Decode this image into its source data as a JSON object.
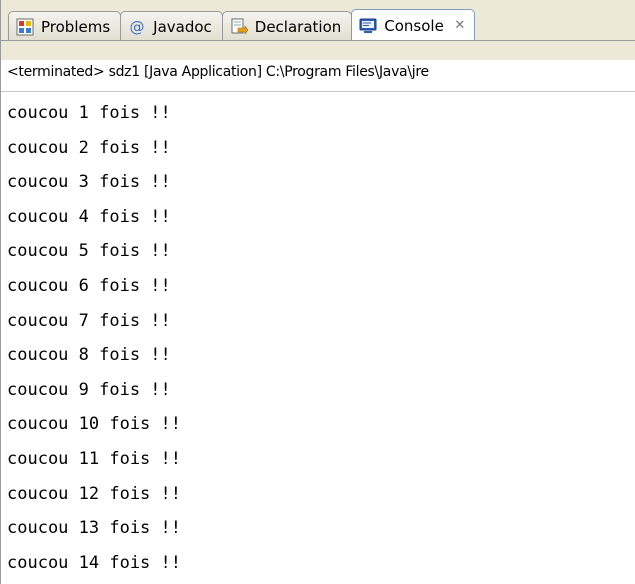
{
  "tabs": [
    {
      "label": "Problems",
      "icon": "problems-icon",
      "active": false
    },
    {
      "label": "Javadoc",
      "icon": "javadoc-icon",
      "active": false
    },
    {
      "label": "Declaration",
      "icon": "declaration-icon",
      "active": false
    },
    {
      "label": "Console",
      "icon": "console-icon",
      "active": true
    }
  ],
  "close_glyph": "✕",
  "status": "<terminated> sdz1 [Java Application] C:\\Program Files\\Java\\jre",
  "output_lines": [
    "coucou 1 fois !!",
    "coucou 2 fois !!",
    "coucou 3 fois !!",
    "coucou 4 fois !!",
    "coucou 5 fois !!",
    "coucou 6 fois !!",
    "coucou 7 fois !!",
    "coucou 8 fois !!",
    "coucou 9 fois !!",
    "coucou 10 fois !!",
    "coucou 11 fois !!",
    "coucou 12 fois !!",
    "coucou 13 fois !!",
    "coucou 14 fois !!"
  ],
  "colors": {
    "tabbar_bg": "#ece9d8",
    "active_tab_border": "#7f9db9",
    "console_icon": "#2b5fb4"
  }
}
